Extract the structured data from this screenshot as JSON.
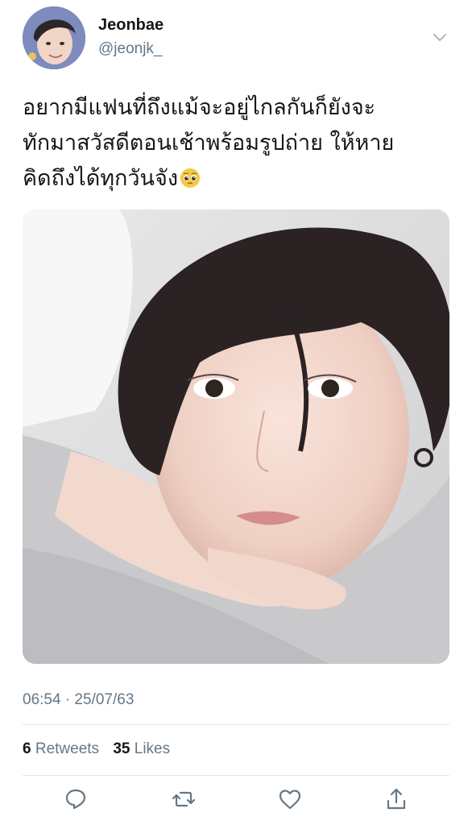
{
  "user": {
    "display_name": "Jeonbae",
    "handle": "@jeonjk_",
    "avatar_icon": "user-avatar"
  },
  "tweet": {
    "text_lines": [
      "อยากมีแฟนที่ถึงแม้จะอยู่ไกลกันก็ยังจะ",
      "ทักมาสวัสดีตอนเช้าพร้อมรูปถ่าย ให้หาย",
      "คิดถึงได้ทุกวันจัง"
    ],
    "emoji": "pleading-face-emoji",
    "photo_icon": "attached-photo",
    "timestamp": "06:54 · 25/07/63"
  },
  "stats": {
    "retweets_count": "6",
    "retweets_label": "Retweets",
    "likes_count": "35",
    "likes_label": "Likes"
  },
  "actions": {
    "reply_icon": "reply-icon",
    "retweet_icon": "retweet-icon",
    "like_icon": "like-icon",
    "share_icon": "share-icon"
  },
  "colors": {
    "text_primary": "#14171a",
    "text_secondary": "#657786",
    "divider": "#e1e8ed",
    "icon": "#657786"
  }
}
